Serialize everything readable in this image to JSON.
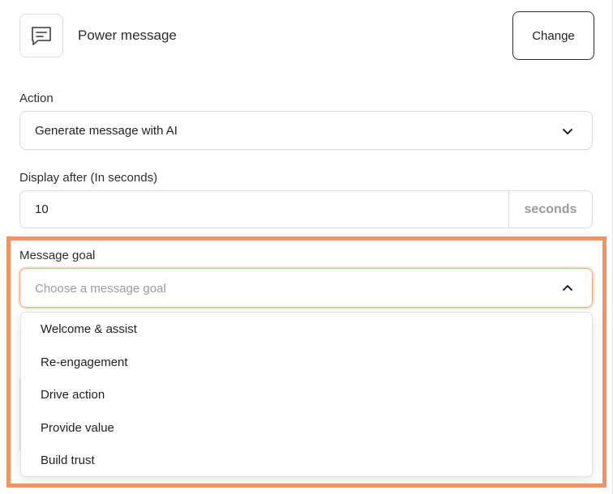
{
  "header": {
    "icon": "message-icon",
    "title": "Power message",
    "change_label": "Change"
  },
  "action": {
    "label": "Action",
    "value": "Generate message with AI"
  },
  "display_after": {
    "label": "Display after (In seconds)",
    "value": "10",
    "suffix": "seconds"
  },
  "message_goal": {
    "label": "Message goal",
    "placeholder": "Choose a message goal",
    "expanded": true,
    "options": [
      "Welcome & assist",
      "Re-engagement",
      "Drive action",
      "Provide value",
      "Build trust"
    ]
  },
  "colors": {
    "highlight": "#f39160",
    "focus_border": "#f3a783",
    "suffix_text": "#9a9a9a"
  }
}
